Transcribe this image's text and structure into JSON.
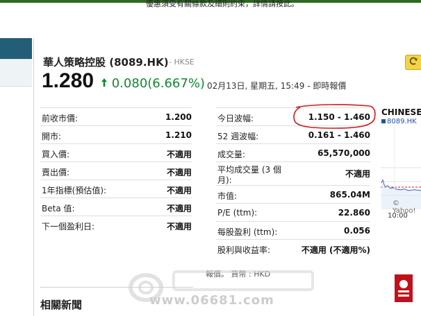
{
  "promo": {
    "text": "優惠須受有關條款及細則約束，詳情請按此。"
  },
  "quote": {
    "title": "華人策略控股 (8089.HK)",
    "exchange": "- HKSE",
    "price": "1.280",
    "change": "0.080(6.667%)",
    "timestamp": "02月13日, 星期五, 15:49 - 即時報價"
  },
  "stats_left": [
    {
      "label": "前收市價:",
      "value": "1.200"
    },
    {
      "label": "開市:",
      "value": "1.210"
    },
    {
      "label": "買入價:",
      "value": "不適用"
    },
    {
      "label": "賣出價:",
      "value": "不適用"
    },
    {
      "label": "1年指標(預估值):",
      "value": "不適用"
    },
    {
      "label": "Beta 值:",
      "value": "不適用"
    },
    {
      "label": "下一個盈利日:",
      "value": "不適用"
    }
  ],
  "stats_right": [
    {
      "label": "今日波幅:",
      "value": "1.150 - 1.460"
    },
    {
      "label": "52 週波幅:",
      "value": "0.161 - 1.460"
    },
    {
      "label": "成交量:",
      "value": "65,570,000"
    },
    {
      "label": "平均成交量 (3 個月):",
      "value": "不適用"
    },
    {
      "label": "市值:",
      "value": "865.04M"
    },
    {
      "label": "P/E (ttm):",
      "value": "22.860"
    },
    {
      "label": "每股盈利 (ttm):",
      "value": "0.056"
    },
    {
      "label": "股利與收益率:",
      "value": "不適用 (不適用%)"
    }
  ],
  "footnote": "報價。 貨幣 : HKD",
  "related_news": "相關新聞",
  "side": {
    "title": "CHINESE",
    "code": "8089.HK",
    "chart_credit": "© Yahoo!",
    "chart_time": "10:00"
  },
  "watermark": "www.06681.com",
  "colors": {
    "accent_green": "#0f8a2f",
    "brand_teal": "#235e77",
    "annotation_red": "#d11a1a"
  },
  "icons": {
    "refresh": "refresh-icon",
    "up_arrow": "up-arrow-icon"
  }
}
